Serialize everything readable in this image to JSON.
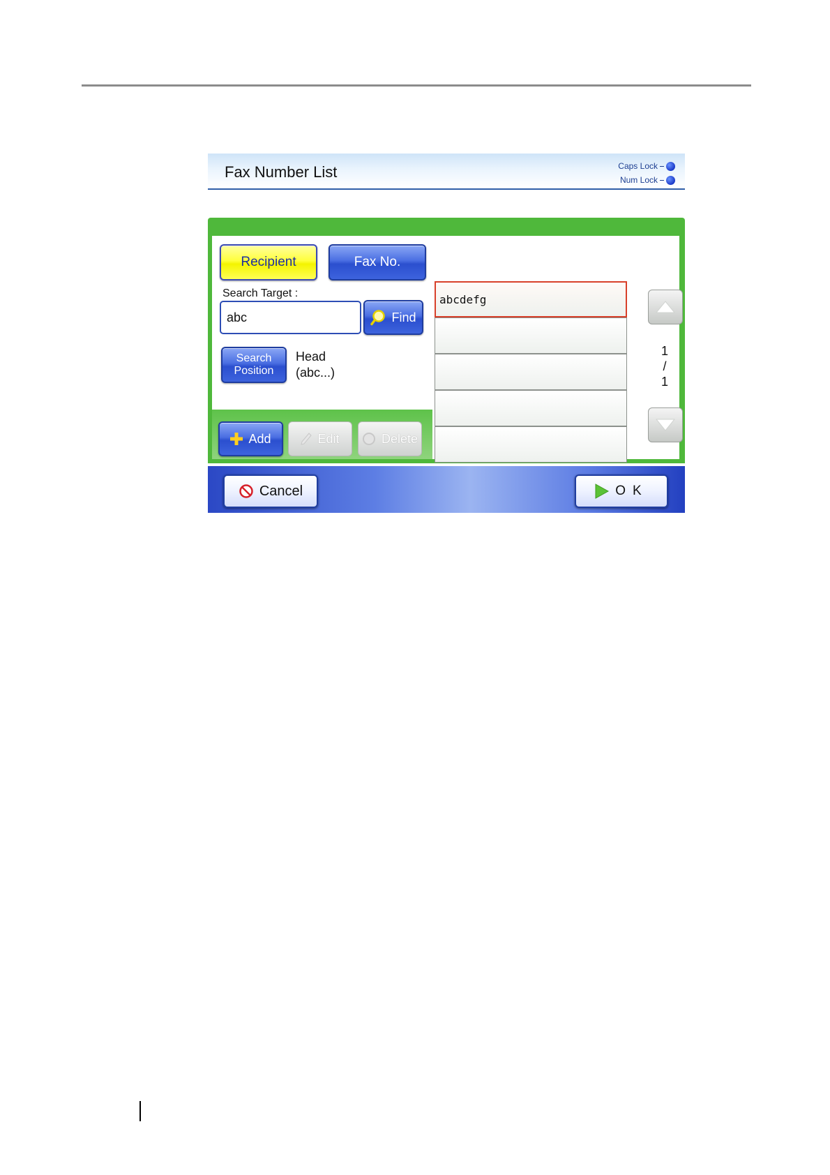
{
  "window": {
    "title": "Fax Number List",
    "caps_lock_label": "Caps Lock",
    "num_lock_label": "Num Lock"
  },
  "search": {
    "mode_recipient_label": "Recipient",
    "mode_faxno_label": "Fax No.",
    "target_label": "Search Target :",
    "target_value": "abc",
    "find_label": "Find",
    "position_label_line1": "Search",
    "position_label_line2": "Position",
    "position_value_line1": "Head",
    "position_value_line2": "(abc...)"
  },
  "actions": {
    "add_label": "Add",
    "edit_label": "Edit",
    "delete_label": "Delete"
  },
  "list": {
    "items": [
      "abcdefg",
      "",
      "",
      "",
      ""
    ],
    "selected_index": 0
  },
  "pagination": {
    "current": "1",
    "separator": "/",
    "total": "1"
  },
  "footer": {
    "cancel_label": "Cancel",
    "ok_label": "OK"
  },
  "colors": {
    "accent_blue": "#2b4fcf",
    "panel_green": "#4fb83b",
    "selected_mode_yellow": "#ffff3c",
    "selected_item_border": "#d8402a"
  },
  "icons": {
    "find": "magnifier-icon",
    "add": "plus-icon",
    "edit": "pencil-icon",
    "delete": "delete-circle-icon",
    "cancel": "prohibited-icon",
    "ok": "play-arrow-icon",
    "scroll_up": "triangle-up-icon",
    "scroll_down": "triangle-down-icon"
  }
}
